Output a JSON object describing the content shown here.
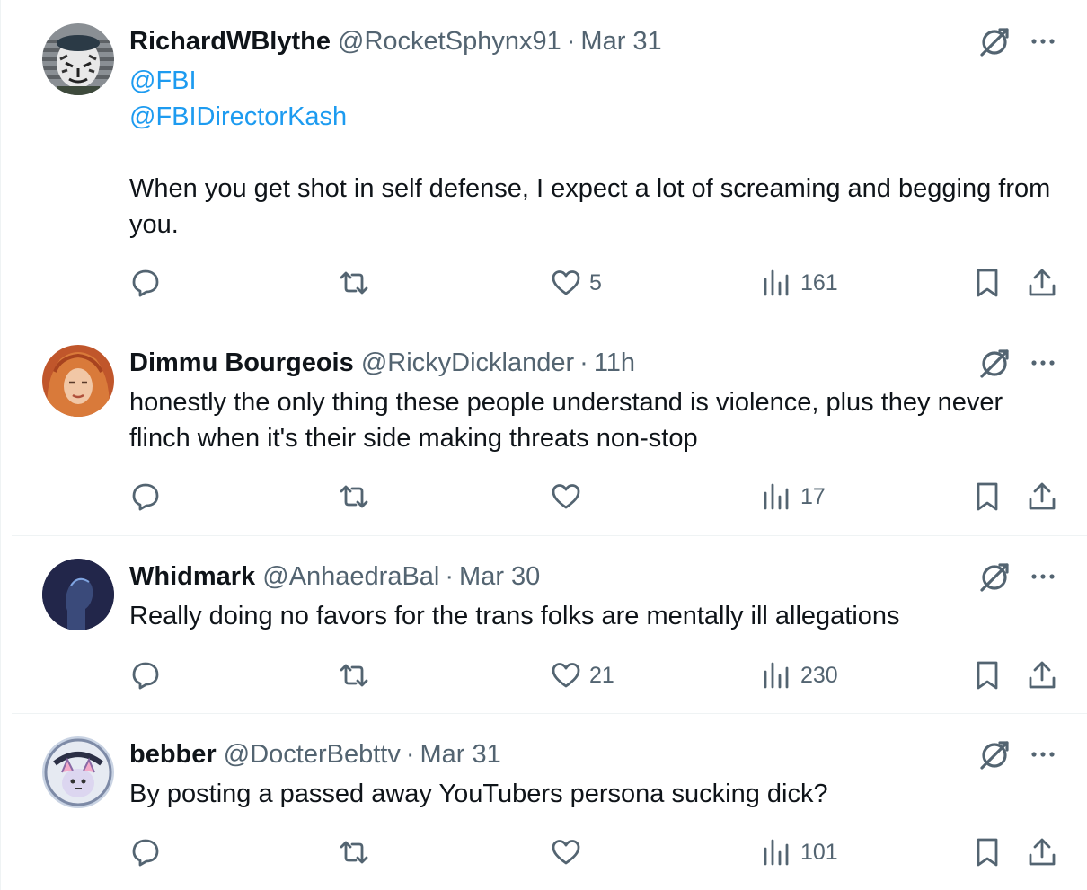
{
  "tweets": [
    {
      "author": "RichardWBlythe",
      "handle": "@RocketSphynx91",
      "separator": "·",
      "time": "Mar 31",
      "mentions": [
        "@FBI",
        "@FBIDirectorKash"
      ],
      "text": "When you get shot in self defense, I expect a lot of screaming and begging from you.",
      "replies": "",
      "reposts": "",
      "likes": "5",
      "views": "161",
      "avatar_icon": "tiger-soldier-avatar"
    },
    {
      "author": "Dimmu Bourgeois",
      "handle": "@RickyDicklander",
      "separator": "·",
      "time": "11h",
      "text": "honestly the only thing these people understand is violence, plus they never flinch when it's their side making threats non-stop",
      "replies": "",
      "reposts": "",
      "likes": "",
      "views": "17",
      "avatar_icon": "red-hair-portrait-avatar"
    },
    {
      "author": "Whidmark",
      "handle": "@AnhaedraBal",
      "separator": "·",
      "time": "Mar 30",
      "text": "Really doing no favors for the trans folks are mentally ill allegations",
      "replies": "",
      "reposts": "",
      "likes": "21",
      "views": "230",
      "avatar_icon": "dark-silhouette-avatar"
    },
    {
      "author": "bebber",
      "handle": "@DocterBebttv",
      "separator": "·",
      "time": "Mar 31",
      "text": "By posting a passed away YouTubers persona sucking dick?",
      "replies": "",
      "reposts": "",
      "likes": "",
      "views": "101",
      "avatar_icon": "cartoon-creature-avatar"
    }
  ],
  "colors": {
    "text": "#0f1419",
    "secondary": "#536471",
    "link": "#1d9bf0",
    "divider": "#eff3f4"
  }
}
